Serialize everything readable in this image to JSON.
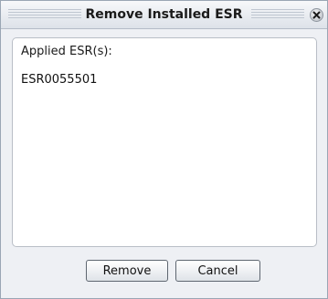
{
  "dialog": {
    "title": "Remove Installed ESR"
  },
  "applied": {
    "legend": "Applied ESR(s):",
    "items": [
      "ESR0055501"
    ]
  },
  "buttons": {
    "remove_label": "Remove",
    "cancel_label": "Cancel"
  },
  "icons": {
    "close": "close-icon"
  },
  "colors": {
    "dialog_bg": "#eef0f4",
    "content_bg": "#ffffff",
    "border": "#9aa6b4"
  }
}
